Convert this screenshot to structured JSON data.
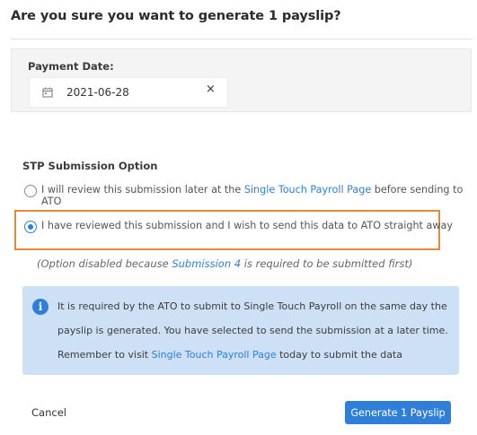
{
  "dialog": {
    "title": "Are you sure you want to generate 1 payslip?"
  },
  "payment_date": {
    "label": "Payment Date:",
    "value": "2021-06-28",
    "clear_glyph": "×"
  },
  "stp": {
    "heading": "STP Submission Option",
    "option_later": {
      "text_before": "I will review this submission later at the ",
      "link": "Single Touch Payroll Page",
      "text_after": " before sending to ATO",
      "selected": false
    },
    "option_now": {
      "text": "I have reviewed this submission and I wish to send this data to ATO straight away",
      "selected": true
    },
    "disabled_note": {
      "before": "(Option disabled because ",
      "link": "Submission 4",
      "after": " is required to be submitted first)"
    }
  },
  "info": {
    "icon": "info-icon",
    "line1": "It is required by the ATO to submit to Single Touch Payroll on the same day the",
    "line2": "payslip is generated. You have selected to send the submission at a later time.",
    "line3_before": "Remember to visit ",
    "line3_link": "Single Touch Payroll Page",
    "line3_after": " today to submit the data"
  },
  "actions": {
    "cancel": "Cancel",
    "confirm": "Generate 1 Payslip"
  },
  "colors": {
    "primary": "#2f7fd8",
    "highlight_border": "#e08a3a",
    "info_background": "#cde0f5"
  }
}
